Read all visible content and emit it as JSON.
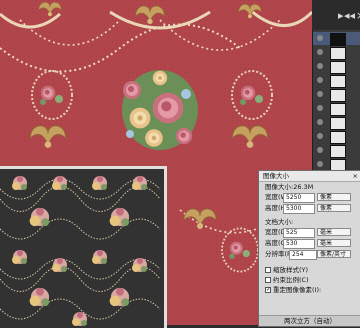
{
  "layers_panel": {
    "rows": 10,
    "active_row": 1,
    "icons": [
      "play-icon",
      "collapse-icon",
      "close-icon"
    ]
  },
  "dialog": {
    "title": "图像大小",
    "close": "×",
    "image_size_label": "图像大小:26.3M",
    "width_label": "宽度(W):",
    "width_value": "5250",
    "height_label": "高度(H):",
    "height_value": "5300",
    "pixel_unit_1": "像素",
    "pixel_unit_2": "像素",
    "doc_size_label": "文档大小:",
    "doc_width_label": "宽度(D):",
    "doc_width_value": "525",
    "doc_height_label": "高度(G):",
    "doc_height_value": "530",
    "resolution_label": "分辨率(R):",
    "resolution_value": "254",
    "unit_mm_1": "毫米",
    "unit_mm_2": "毫米",
    "unit_ppi": "像素/英寸",
    "scale_styles": "缩放样式(Y)",
    "constrain": "约束比例(C)",
    "resample": "重定图像像素(I):",
    "method": "两次立方（自动）"
  }
}
